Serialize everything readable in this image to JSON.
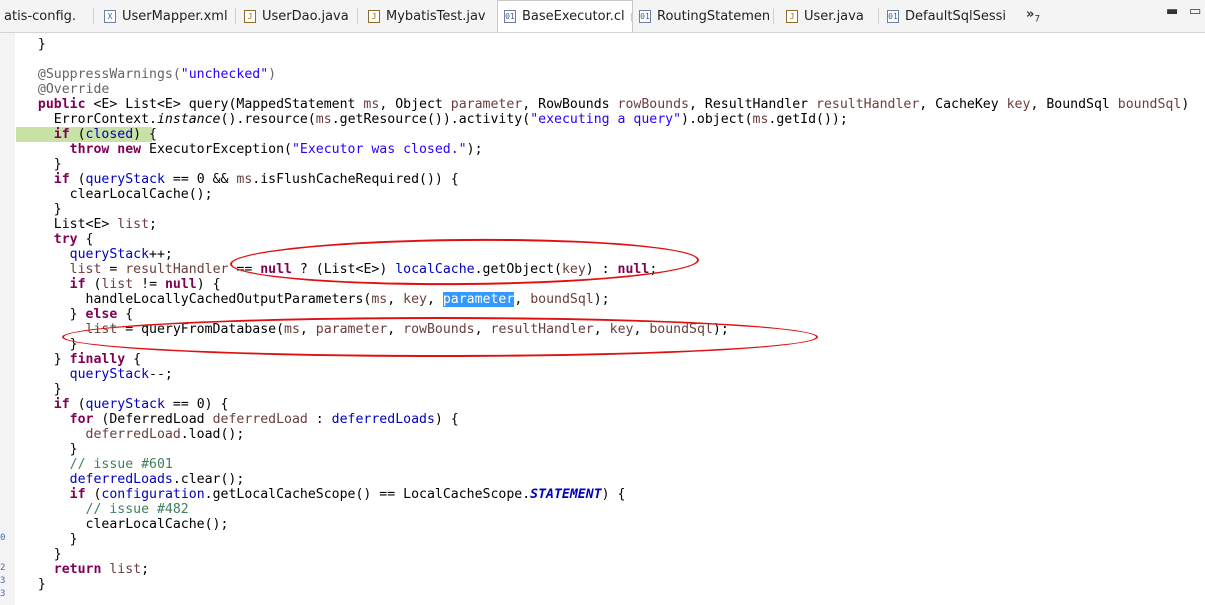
{
  "tabs": [
    {
      "label": "atis-config.",
      "icon": "xml-file-icon",
      "active": false
    },
    {
      "label": "UserMapper.xml",
      "icon": "xml-file-icon",
      "active": false
    },
    {
      "label": "UserDao.java",
      "icon": "java-file-icon",
      "active": false
    },
    {
      "label": "MybatisTest.jav",
      "icon": "java-file-icon",
      "active": false
    },
    {
      "label": "BaseExecutor.cl",
      "icon": "class-file-icon",
      "active": true
    },
    {
      "label": "RoutingStatemen",
      "icon": "class-file-icon",
      "active": false
    },
    {
      "label": "User.java",
      "icon": "java-file-icon",
      "active": false
    },
    {
      "label": "DefaultSqlSessi",
      "icon": "class-file-icon",
      "active": false
    }
  ],
  "overflow": {
    "glyph": "»",
    "count": "7"
  },
  "ruler_numbers": [
    "0",
    "2",
    "3",
    "3"
  ],
  "code_lines": [
    [
      [
        "p",
        "  }"
      ]
    ],
    [
      [
        "p",
        ""
      ]
    ],
    [
      [
        "ann",
        "  @SuppressWarnings("
      ],
      [
        "str",
        "\"unchecked\""
      ],
      [
        "ann",
        ")"
      ]
    ],
    [
      [
        "ann",
        "  @Override"
      ]
    ],
    [
      [
        "kw",
        "  public"
      ],
      [
        "p",
        " <E> List<E> query(MappedStatement "
      ],
      [
        "prm",
        "ms"
      ],
      [
        "p",
        ", Object "
      ],
      [
        "prm",
        "parameter"
      ],
      [
        "p",
        ", RowBounds "
      ],
      [
        "prm",
        "rowBounds"
      ],
      [
        "p",
        ", ResultHandler "
      ],
      [
        "prm",
        "resultHandler"
      ],
      [
        "p",
        ", CacheKey "
      ],
      [
        "prm",
        "key"
      ],
      [
        "p",
        ", BoundSql "
      ],
      [
        "prm",
        "boundSql"
      ],
      [
        "p",
        ")"
      ]
    ],
    [
      [
        "p",
        "    ErrorContext."
      ],
      [
        "itl",
        "instance"
      ],
      [
        "p",
        "().resource("
      ],
      [
        "prm",
        "ms"
      ],
      [
        "p",
        ".getResource()).activity("
      ],
      [
        "str",
        "\"executing a query\""
      ],
      [
        "p",
        ").object("
      ],
      [
        "prm",
        "ms"
      ],
      [
        "p",
        ".getId());"
      ]
    ],
    [
      [
        "kw",
        "    if"
      ],
      [
        "p",
        " ("
      ],
      [
        "fld",
        "closed"
      ],
      [
        "p",
        ") {"
      ]
    ],
    [
      [
        "kw",
        "      throw new"
      ],
      [
        "p",
        " ExecutorException("
      ],
      [
        "str",
        "\"Executor was closed.\""
      ],
      [
        "p",
        ");"
      ]
    ],
    [
      [
        "p",
        "    }"
      ]
    ],
    [
      [
        "kw",
        "    if"
      ],
      [
        "p",
        " ("
      ],
      [
        "fld",
        "queryStack"
      ],
      [
        "p",
        " == 0 && "
      ],
      [
        "prm",
        "ms"
      ],
      [
        "p",
        ".isFlushCacheRequired()) {"
      ]
    ],
    [
      [
        "p",
        "      clearLocalCache();"
      ]
    ],
    [
      [
        "p",
        "    }"
      ]
    ],
    [
      [
        "p",
        "    List<E> "
      ],
      [
        "prm",
        "list"
      ],
      [
        "p",
        ";"
      ]
    ],
    [
      [
        "kw",
        "    try"
      ],
      [
        "p",
        " {"
      ]
    ],
    [
      [
        "fld",
        "      queryStack"
      ],
      [
        "p",
        "++;"
      ]
    ],
    [
      [
        "prm",
        "      list"
      ],
      [
        "p",
        " = "
      ],
      [
        "prm",
        "resultHandler"
      ],
      [
        "p",
        " == "
      ],
      [
        "kw",
        "null"
      ],
      [
        "p",
        " ? (List<E>) "
      ],
      [
        "fld",
        "localCache"
      ],
      [
        "p",
        ".getObject("
      ],
      [
        "prm",
        "key"
      ],
      [
        "p",
        ") : "
      ],
      [
        "kw",
        "null"
      ],
      [
        "p",
        ";"
      ]
    ],
    [
      [
        "kw",
        "      if"
      ],
      [
        "p",
        " ("
      ],
      [
        "prm",
        "list"
      ],
      [
        "p",
        " != "
      ],
      [
        "kw",
        "null"
      ],
      [
        "p",
        ") {"
      ]
    ],
    [
      [
        "p",
        "        handleLocallyCachedOutputParameters("
      ],
      [
        "prm",
        "ms"
      ],
      [
        "p",
        ", "
      ],
      [
        "prm",
        "key"
      ],
      [
        "p",
        ", "
      ],
      [
        "sel",
        "parameter"
      ],
      [
        "p",
        ", "
      ],
      [
        "prm",
        "boundSql"
      ],
      [
        "p",
        ");"
      ]
    ],
    [
      [
        "p",
        "      } "
      ],
      [
        "kw",
        "else"
      ],
      [
        "p",
        " {"
      ]
    ],
    [
      [
        "prm",
        "        list"
      ],
      [
        "p",
        " = queryFromDatabase("
      ],
      [
        "prm",
        "ms"
      ],
      [
        "p",
        ", "
      ],
      [
        "prm",
        "parameter"
      ],
      [
        "p",
        ", "
      ],
      [
        "prm",
        "rowBounds"
      ],
      [
        "p",
        ", "
      ],
      [
        "prm",
        "resultHandler"
      ],
      [
        "p",
        ", "
      ],
      [
        "prm",
        "key"
      ],
      [
        "p",
        ", "
      ],
      [
        "prm",
        "boundSql"
      ],
      [
        "p",
        ");"
      ]
    ],
    [
      [
        "p",
        "      }"
      ]
    ],
    [
      [
        "p",
        "    } "
      ],
      [
        "kw",
        "finally"
      ],
      [
        "p",
        " {"
      ]
    ],
    [
      [
        "fld",
        "      queryStack"
      ],
      [
        "p",
        "--;"
      ]
    ],
    [
      [
        "p",
        "    }"
      ]
    ],
    [
      [
        "kw",
        "    if"
      ],
      [
        "p",
        " ("
      ],
      [
        "fld",
        "queryStack"
      ],
      [
        "p",
        " == 0) {"
      ]
    ],
    [
      [
        "kw",
        "      for"
      ],
      [
        "p",
        " (DeferredLoad "
      ],
      [
        "prm",
        "deferredLoad"
      ],
      [
        "p",
        " : "
      ],
      [
        "fld",
        "deferredLoads"
      ],
      [
        "p",
        ") {"
      ]
    ],
    [
      [
        "prm",
        "        deferredLoad"
      ],
      [
        "p",
        ".load();"
      ]
    ],
    [
      [
        "p",
        "      }"
      ]
    ],
    [
      [
        "com",
        "      // issue #601"
      ]
    ],
    [
      [
        "fld",
        "      deferredLoads"
      ],
      [
        "p",
        ".clear();"
      ]
    ],
    [
      [
        "kw",
        "      if"
      ],
      [
        "p",
        " ("
      ],
      [
        "fld",
        "configuration"
      ],
      [
        "p",
        ".getLocalCacheScope() == LocalCacheScope."
      ],
      [
        "stat",
        "STATEMENT"
      ],
      [
        "p",
        ") {"
      ]
    ],
    [
      [
        "com",
        "        // issue #482"
      ]
    ],
    [
      [
        "p",
        "        clearLocalCache();"
      ]
    ],
    [
      [
        "p",
        "      }"
      ]
    ],
    [
      [
        "p",
        "    }"
      ]
    ],
    [
      [
        "kw",
        "    return"
      ],
      [
        "p",
        " "
      ],
      [
        "prm",
        "list"
      ],
      [
        "p",
        ";"
      ]
    ],
    [
      [
        "p",
        "  }"
      ]
    ]
  ],
  "highlighted_line": 6,
  "colors": {
    "keyword": "#7f0055",
    "string": "#2a00ff",
    "field": "#0000c0",
    "param": "#6a3e3e",
    "annotation": "#646464",
    "comment": "#3f7f5f",
    "line_highlight": "#c8e1a5",
    "selection": "#3399ff",
    "circle_markup": "#e01010"
  }
}
